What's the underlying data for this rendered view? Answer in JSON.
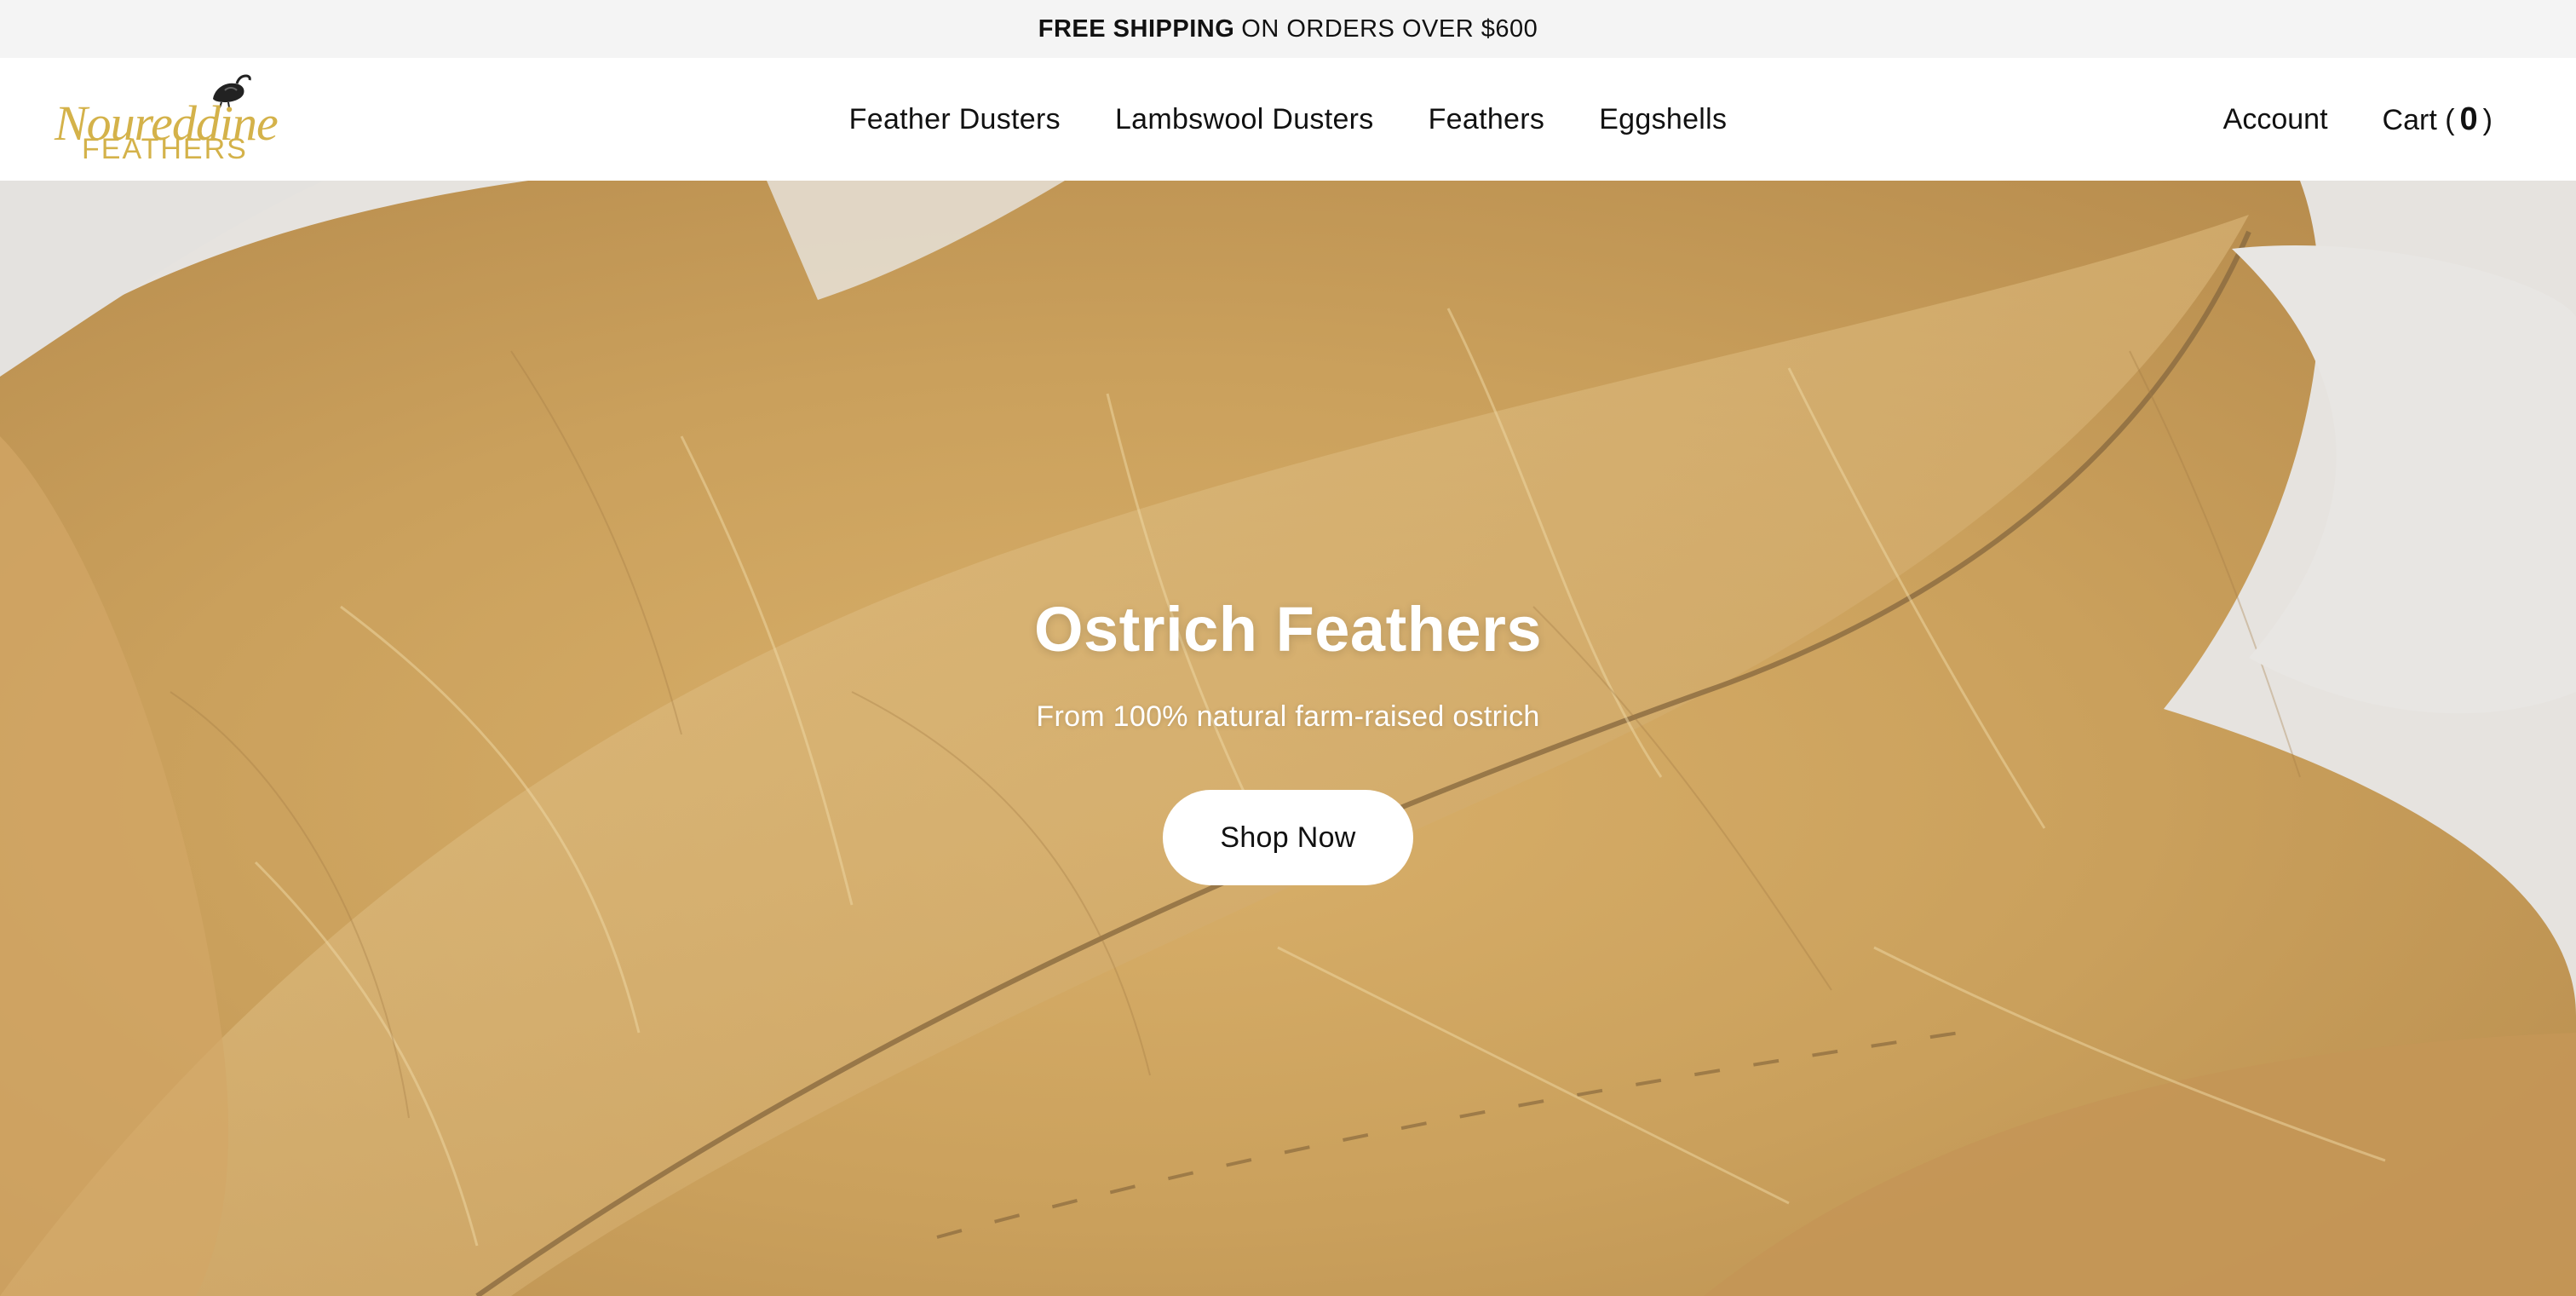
{
  "announcement": {
    "bold_text": "FREE SHIPPING",
    "text": "ON ORDERS OVER $600"
  },
  "logo": {
    "line1": "Noureddine",
    "line2": "FEATHERS",
    "brand_color": "#d4b24a"
  },
  "nav": {
    "items": [
      {
        "label": "Feather Dusters"
      },
      {
        "label": "Lambswool Dusters"
      },
      {
        "label": "Feathers"
      },
      {
        "label": "Eggshells"
      }
    ]
  },
  "utility": {
    "account_label": "Account",
    "cart_label": "Cart (",
    "cart_count": "0",
    "cart_close": ")"
  },
  "hero": {
    "title": "Ostrich Feathers",
    "subtitle": "From 100% natural farm-raised ostrich",
    "cta_label": "Shop Now",
    "image": "ostrich-feather-photo",
    "feather_color": "#d6ad63"
  },
  "colors": {
    "announcement_bg": "#f4f4f4",
    "header_bg": "#ffffff",
    "text": "#111111",
    "button_bg": "#ffffff"
  }
}
